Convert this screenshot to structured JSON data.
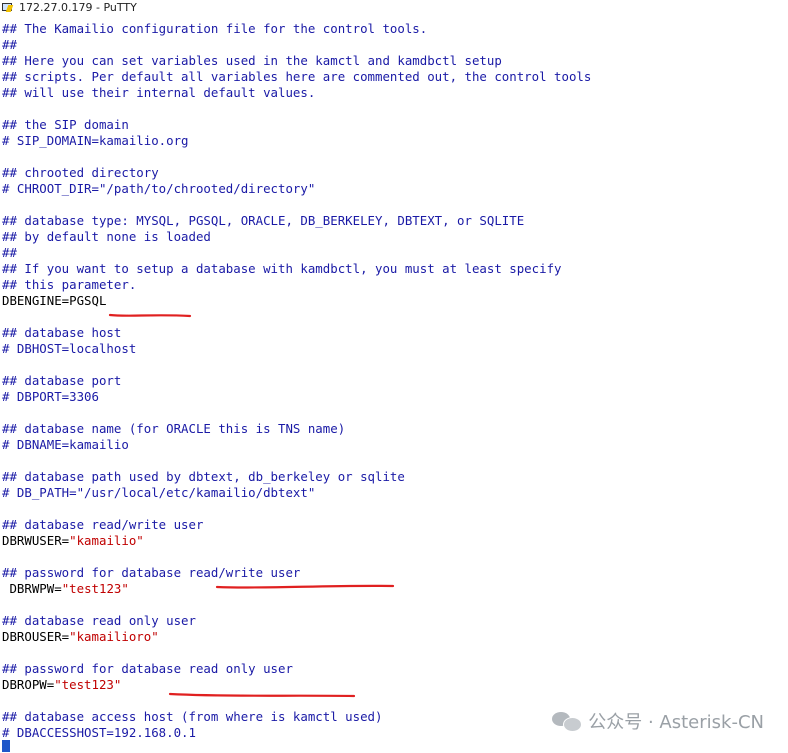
{
  "window": {
    "title": "172.27.0.179 - PuTTY"
  },
  "terminal": {
    "lines": [
      {
        "kind": "comment",
        "text": "## The Kamailio configuration file for the control tools."
      },
      {
        "kind": "comment",
        "text": "##"
      },
      {
        "kind": "comment",
        "text": "## Here you can set variables used in the kamctl and kamdbctl setup"
      },
      {
        "kind": "comment",
        "text": "## scripts. Per default all variables here are commented out, the control tools"
      },
      {
        "kind": "comment",
        "text": "## will use their internal default values."
      },
      {
        "kind": "blank",
        "text": ""
      },
      {
        "kind": "comment",
        "text": "## the SIP domain"
      },
      {
        "kind": "comment",
        "text": "# SIP_DOMAIN=kamailio.org"
      },
      {
        "kind": "blank",
        "text": ""
      },
      {
        "kind": "comment",
        "text": "## chrooted directory"
      },
      {
        "kind": "comment",
        "text": "# CHROOT_DIR=\"/path/to/chrooted/directory\""
      },
      {
        "kind": "blank",
        "text": ""
      },
      {
        "kind": "comment",
        "text": "## database type: MYSQL, PGSQL, ORACLE, DB_BERKELEY, DBTEXT, or SQLITE"
      },
      {
        "kind": "comment",
        "text": "## by default none is loaded"
      },
      {
        "kind": "comment",
        "text": "##"
      },
      {
        "kind": "comment",
        "text": "## If you want to setup a database with kamdbctl, you must at least specify"
      },
      {
        "kind": "comment",
        "text": "## this parameter."
      },
      {
        "kind": "setting",
        "text": "DBENGINE=PGSQL"
      },
      {
        "kind": "blank",
        "text": ""
      },
      {
        "kind": "comment",
        "text": "## database host"
      },
      {
        "kind": "comment",
        "text": "# DBHOST=localhost"
      },
      {
        "kind": "blank",
        "text": ""
      },
      {
        "kind": "comment",
        "text": "## database port"
      },
      {
        "kind": "comment",
        "text": "# DBPORT=3306"
      },
      {
        "kind": "blank",
        "text": ""
      },
      {
        "kind": "comment",
        "text": "## database name (for ORACLE this is TNS name)"
      },
      {
        "kind": "comment",
        "text": "# DBNAME=kamailio"
      },
      {
        "kind": "blank",
        "text": ""
      },
      {
        "kind": "comment",
        "text": "## database path used by dbtext, db_berkeley or sqlite"
      },
      {
        "kind": "comment",
        "text": "# DB_PATH=\"/usr/local/etc/kamailio/dbtext\""
      },
      {
        "kind": "blank",
        "text": ""
      },
      {
        "kind": "comment",
        "text": "## database read/write user"
      },
      {
        "kind": "setting",
        "key": "DBRWUSER=",
        "value": "\"kamailio\""
      },
      {
        "kind": "blank",
        "text": ""
      },
      {
        "kind": "comment",
        "text": "## password for database read/write user"
      },
      {
        "kind": "setting",
        "key": " DBRWPW=",
        "value": "\"test123\""
      },
      {
        "kind": "blank",
        "text": ""
      },
      {
        "kind": "comment",
        "text": "## database read only user"
      },
      {
        "kind": "setting",
        "key": "DBROUSER=",
        "value": "\"kamailioro\""
      },
      {
        "kind": "blank",
        "text": ""
      },
      {
        "kind": "comment",
        "text": "## password for database read only user"
      },
      {
        "kind": "setting",
        "key": "DBROPW=",
        "value": "\"test123\""
      },
      {
        "kind": "blank",
        "text": ""
      },
      {
        "kind": "comment",
        "text": "## database access host (from where is kamctl used)"
      },
      {
        "kind": "comment",
        "text": "# DBACCESSHOST=192.168.0.1"
      }
    ]
  },
  "watermark": {
    "text": "公众号 · Asterisk-CN"
  },
  "colors": {
    "comment": "#1a1aa6",
    "setting": "#000000",
    "string": "#c00000",
    "underline": "#e02020",
    "cursor": "#1f57c9"
  }
}
